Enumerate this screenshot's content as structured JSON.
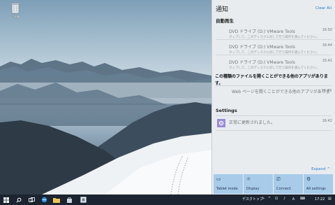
{
  "desktop": {
    "icon": "recycle-bin-icon",
    "recycle_bin_label": "ごみ箱"
  },
  "action_center": {
    "header": "通知",
    "clear_all": "Clear All",
    "group_autoplay": {
      "title": "自動再生",
      "items": [
        {
          "title": "DVD ドライブ (D:) VMware Tools",
          "subtitle": "タップして、このディスクに対して行う操作を選んでください。",
          "time": "16:50"
        },
        {
          "title": "DVD ドライブ (D:) VMware Tools",
          "subtitle": "タップして、このディスクに対して行う操作を選んでください。",
          "time": "16:44"
        },
        {
          "title": "DVD ドライブ (D:) VMware Tools",
          "subtitle": "タップして、このディスクに対して行う操作を選んでください。",
          "time": "15:41"
        }
      ],
      "message_line1": "この種類のファイルを開くことができる他のアプリがありま",
      "message_line2": "す。",
      "web_message": "Web ページを開くことができる他のアプリがありま",
      "web_time": "16:49"
    },
    "group_settings": {
      "title": "Settings",
      "message": "正常に更新されました。",
      "time": "16:42"
    },
    "expand": "Expand",
    "quick_actions": [
      {
        "label": "Tablet mode",
        "icon": "tablet-mode-icon"
      },
      {
        "label": "Display",
        "icon": "display-icon"
      },
      {
        "label": "Connect",
        "icon": "connect-icon"
      },
      {
        "label": "All settings",
        "icon": "settings-gear-icon"
      }
    ]
  },
  "taskbar": {
    "desktop_toolbar": "デスクトップ",
    "clock": "17:22",
    "accent": "#1b2430"
  }
}
